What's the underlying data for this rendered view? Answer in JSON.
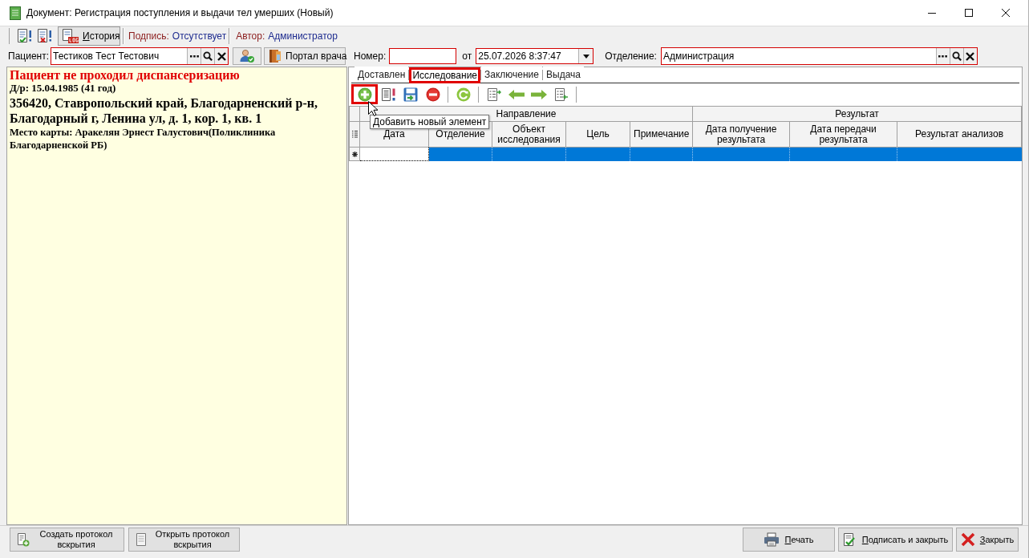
{
  "window": {
    "title": "Документ: Регистрация поступления и выдачи тел умерших (Новый)"
  },
  "toolbar": {
    "history_button": {
      "label": "История"
    },
    "signature": {
      "label": "Подпись:",
      "value": "Отсутствует"
    },
    "author": {
      "label": "Автор:",
      "value": "Администратор"
    }
  },
  "patient": {
    "label": "Пациент:",
    "value": "Тестиков Тест Тестович"
  },
  "portal_button": {
    "label": "Портал врача"
  },
  "number": {
    "label": "Номер:"
  },
  "date": {
    "label": "от",
    "value": "25.07.2026 8:37:47"
  },
  "department": {
    "label": "Отделение:",
    "value": "Администрация"
  },
  "patient_info": {
    "warning": "Пациент не проходил диспансеризацию",
    "birth_date": "Д/р: 15.04.1985 (41 год)",
    "address": "356420, Ставропольский край, Благодарненский р-н, Благодарный г, Ленина ул, д. 1, кор. 1, кв. 1",
    "card_location": "Место карты: Аракелян Эрнест Галустович(Поликлиника Благодарненской РБ)"
  },
  "tabs": [
    {
      "label": "Доставлен",
      "selected": false,
      "highlighted": false
    },
    {
      "label": "Исследование",
      "selected": true,
      "highlighted": true
    },
    {
      "label": "Заключение",
      "selected": false,
      "highlighted": false
    },
    {
      "label": "Выдача",
      "selected": false,
      "highlighted": false
    }
  ],
  "grid_toolbar": {
    "add_button": {
      "highlighted": true,
      "tooltip": "Добавить новый элемент"
    }
  },
  "table": {
    "column_groups": [
      {
        "label": "Направление",
        "columns": [
          "Дата",
          "Отделение",
          "Объект исследования",
          "Цель",
          "Примечание"
        ]
      },
      {
        "label": "Результат",
        "columns": [
          "Дата получение результата",
          "Дата передачи результата",
          "Результат анализов"
        ]
      }
    ],
    "rows": [
      {
        "selected": true
      }
    ]
  },
  "bottom_bar": {
    "left_buttons": [
      {
        "kind": "create",
        "label": "Создать протокол вскрытия"
      },
      {
        "kind": "open",
        "label": "Открыть протокол вскрытия"
      }
    ],
    "right_buttons": [
      {
        "kind": "print",
        "label": "Печать"
      },
      {
        "kind": "sign",
        "label": "Подписать и закрыть"
      },
      {
        "kind": "close",
        "label": "Закрыть"
      }
    ]
  }
}
